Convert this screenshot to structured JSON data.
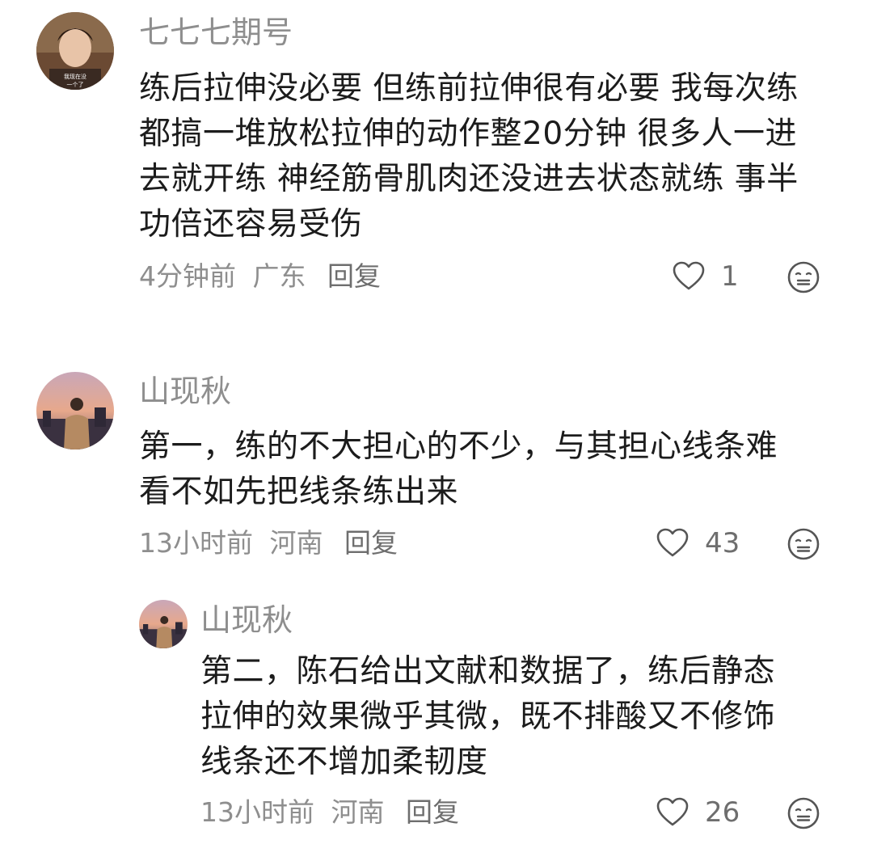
{
  "comments": [
    {
      "username": "七七七期号",
      "avatar_icon": "portrait-avatar-period-drama",
      "content_lines": [
        "练后拉伸没必要 但练前拉伸很有必要 我每次练",
        "都搞一堆放松拉伸的动作整20分钟 很多人一进",
        "去就开练 神经筋骨肌肉还没进去状态就练 事半",
        "功倍还容易受伤"
      ],
      "time": "4分钟前",
      "location": "广东",
      "reply_label": "回复",
      "like_count": "1"
    },
    {
      "username": "山现秋",
      "avatar_icon": "portrait-avatar-sunset",
      "content_lines": [
        "第一，练的不大担心的不少，与其担心线条难",
        "看不如先把线条练出来"
      ],
      "time": "13小时前",
      "location": "河南",
      "reply_label": "回复",
      "like_count": "43"
    },
    {
      "username": "山现秋",
      "avatar_icon": "portrait-avatar-sunset",
      "content_lines": [
        "第二，陈石给出文献和数据了，练后静态",
        "拉伸的效果微乎其微，既不排酸又不修饰",
        "线条还不增加柔韧度"
      ],
      "time": "13小时前",
      "location": "河南",
      "reply_label": "回复",
      "like_count": "26"
    }
  ],
  "icons": {
    "like": "heart-outline-icon",
    "emoji": "emoji-face-icon"
  },
  "colors": {
    "text_primary": "#1c1c1c",
    "text_secondary": "#8e8e8e",
    "icon_gray": "#555555"
  }
}
